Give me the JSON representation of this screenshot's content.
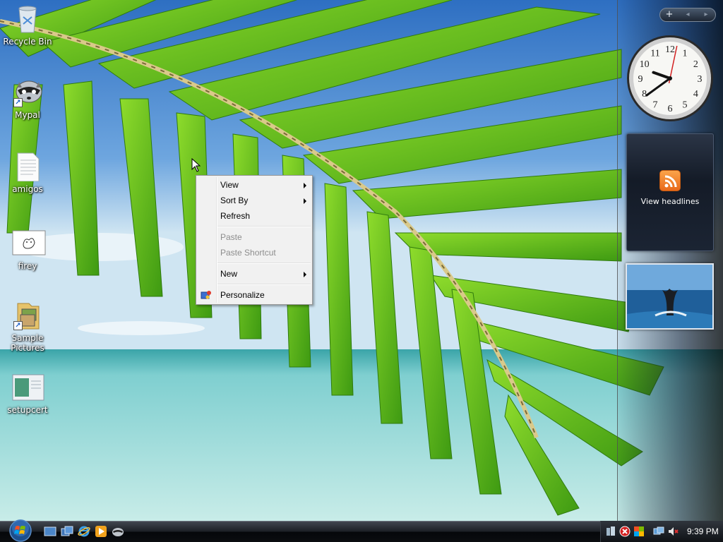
{
  "desktop": {
    "icons": [
      {
        "label": "Recycle Bin",
        "icon": "recycle-bin-icon"
      },
      {
        "label": "Mypal",
        "icon": "raccoon-icon"
      },
      {
        "label": "amigos",
        "icon": "text-document-icon"
      },
      {
        "label": "firey",
        "icon": "image-file-icon"
      },
      {
        "label": "Sample\nPictures",
        "icon": "folder-icon"
      },
      {
        "label": "setupcert",
        "icon": "setup-file-icon"
      }
    ]
  },
  "context_menu": {
    "items": [
      {
        "label": "View",
        "submenu": true,
        "enabled": true
      },
      {
        "label": "Sort By",
        "submenu": true,
        "enabled": true
      },
      {
        "label": "Refresh",
        "submenu": false,
        "enabled": true
      },
      {
        "label": "Paste",
        "submenu": false,
        "enabled": false
      },
      {
        "label": "Paste Shortcut",
        "submenu": false,
        "enabled": false
      },
      {
        "label": "New",
        "submenu": true,
        "enabled": true
      },
      {
        "label": "Personalize",
        "submenu": false,
        "enabled": true,
        "icon": "personalize-icon"
      }
    ]
  },
  "sidebar": {
    "controls": {
      "add": "+",
      "prev": "◂",
      "next": "▸"
    },
    "feed_gadget": {
      "label": "View headlines"
    },
    "clock_gadget": {
      "hour": 9,
      "minute": 39,
      "second": 2,
      "numerals": [
        "12",
        "1",
        "2",
        "3",
        "4",
        "5",
        "6",
        "7",
        "8",
        "9",
        "10",
        "11"
      ]
    },
    "photo_gadget": {
      "subject": "whale-tail"
    }
  },
  "taskbar": {
    "time": "9:39 PM",
    "quick_launch": [
      "show-desktop-icon",
      "switch-windows-icon",
      "internet-explorer-icon",
      "media-player-icon",
      "mypal-icon"
    ],
    "tray_icons": [
      "network-icon",
      "security-alert-icon",
      "windows-update-icon",
      "connection-icon",
      "volume-muted-icon"
    ]
  },
  "colors": {
    "menu_bg": "#f1f1f1",
    "disabled_text": "#8d8d8d",
    "sky": "#4a90d0",
    "sea": "#a8dfe0",
    "palm_green": "#6cc41c"
  }
}
